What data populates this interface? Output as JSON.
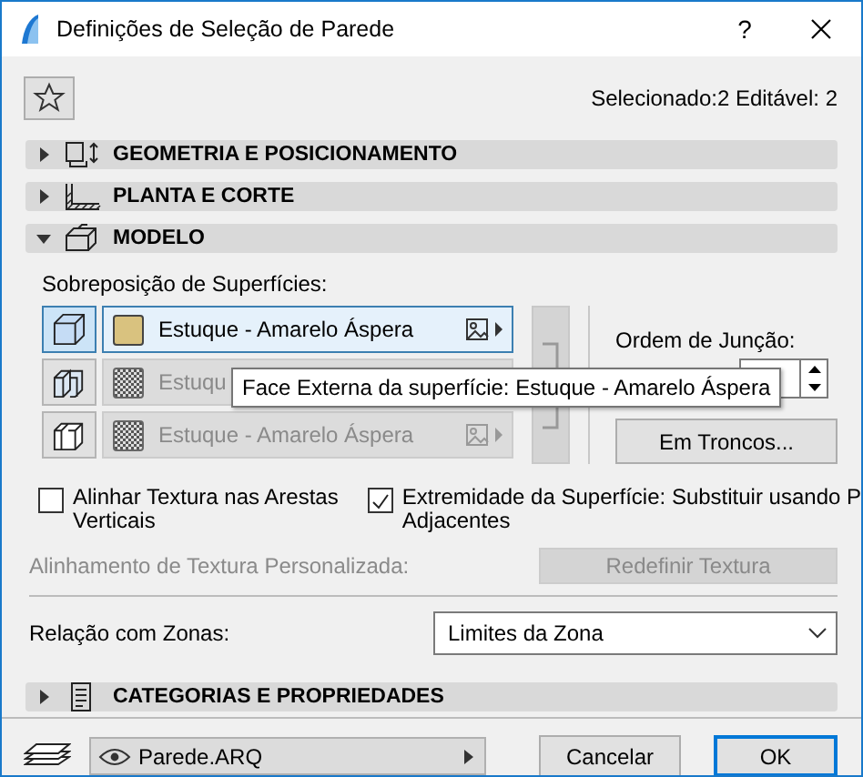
{
  "window": {
    "title": "Definições de Seleção de Parede",
    "help": "?"
  },
  "selection_info": "Selecionado:2 Editável: 2",
  "sections": [
    {
      "title": "GEOMETRIA E POSICIONAMENTO",
      "expanded": false
    },
    {
      "title": "PLANTA E CORTE",
      "expanded": false
    },
    {
      "title": "MODELO",
      "expanded": true
    }
  ],
  "model": {
    "surfaces_label": "Sobreposição de Superfícies:",
    "surfaces": [
      {
        "label": "Estuque - Amarelo Áspera",
        "selected": true,
        "disabled": false
      },
      {
        "label": "Estuqu",
        "selected": false,
        "disabled": true
      },
      {
        "label": "Estuque - Amarelo Áspera",
        "selected": false,
        "disabled": true
      }
    ],
    "tooltip": "Face Externa da superfície: Estuque - Amarelo Áspera",
    "join_order_label": "Ordem de Junção:",
    "trunks_button": "Em Troncos...",
    "checkboxes": [
      {
        "lines": [
          "Alinhar Textura nas Arestas",
          "Verticais"
        ],
        "checked": false
      },
      {
        "lines": [
          "Extremidade da Superfície: Substituir usando P",
          "Adjacentes"
        ],
        "checked": true
      }
    ],
    "custom_alignment_label": "Alinhamento de Textura Personalizada:",
    "reset_texture_button": {
      "label": "Redefinir Textura",
      "disabled": true
    },
    "zones_label": "Relação com Zonas:",
    "zones_value": "Limites da Zona"
  },
  "last_section": {
    "title": "CATEGORIAS E PROPRIEDADES",
    "expanded": false
  },
  "footer": {
    "layer": "Parede.ARQ",
    "buttons": [
      {
        "label": "Cancelar",
        "default": false
      },
      {
        "label": "OK",
        "default": true
      }
    ]
  }
}
